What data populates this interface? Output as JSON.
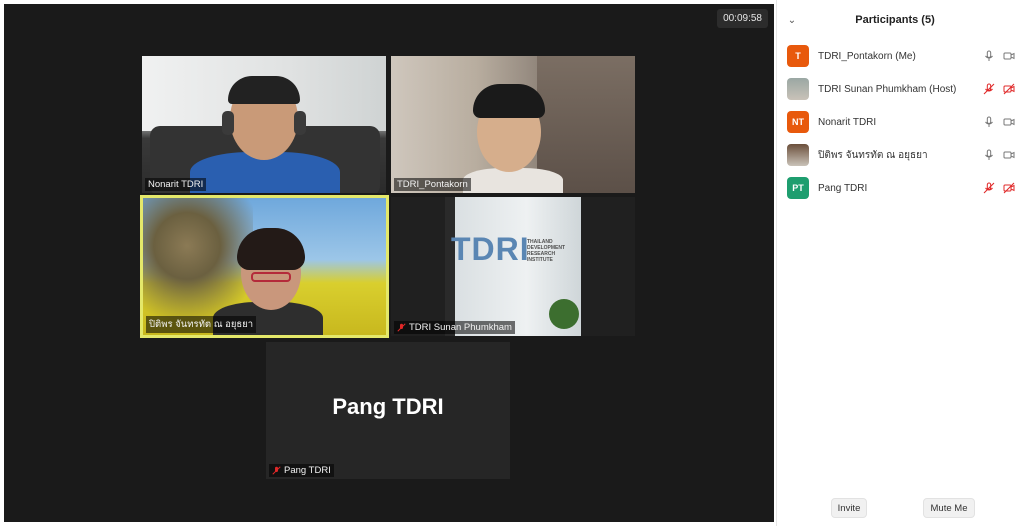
{
  "meeting": {
    "timer": "00:09:58"
  },
  "tiles": [
    {
      "id": "nonarit",
      "name": "Nonarit TDRI",
      "muted": false
    },
    {
      "id": "pontakorn",
      "name": "TDRI_Pontakorn",
      "muted": false
    },
    {
      "id": "pitiporn",
      "name": "ปิติพร  จันทรทัต ณ อยุธยา",
      "muted": false,
      "active_speaker": true
    },
    {
      "id": "sunan",
      "name": "TDRI Sunan Phumkham",
      "muted": true,
      "sign_text": "TDRI",
      "sign_subtext": "THAILAND DEVELOPMENT RESEARCH INSTITUTE"
    },
    {
      "id": "pang",
      "name": "Pang TDRI",
      "muted": true,
      "video_off_label": "Pang TDRI"
    }
  ],
  "participants_panel": {
    "title": "Participants (5)",
    "participants": [
      {
        "initials": "T",
        "name": "TDRI_Pontakorn (Me)",
        "avatar_color": "#e8590c",
        "mic_muted": false,
        "video_off": false
      },
      {
        "initials": "",
        "name": "TDRI Sunan Phumkham (Host)",
        "avatar_color": "#9aa7a3",
        "mic_muted": true,
        "video_off": true
      },
      {
        "initials": "NT",
        "name": "Nonarit TDRI",
        "avatar_color": "#e8590c",
        "mic_muted": false,
        "video_off": false
      },
      {
        "initials": "",
        "name": "ปิติพร  จันทรทัต ณ อยุธยา",
        "avatar_color": "#6b4f3b",
        "mic_muted": false,
        "video_off": false
      },
      {
        "initials": "PT",
        "name": "Pang TDRI",
        "avatar_color": "#1e9e6f",
        "mic_muted": true,
        "video_off": true
      }
    ],
    "invite_label": "Invite",
    "mute_me_label": "Mute Me"
  },
  "colors": {
    "stage_bg": "#1a1a1a",
    "active_speaker_border": "#e4e86a",
    "muted_red": "#e02828"
  }
}
